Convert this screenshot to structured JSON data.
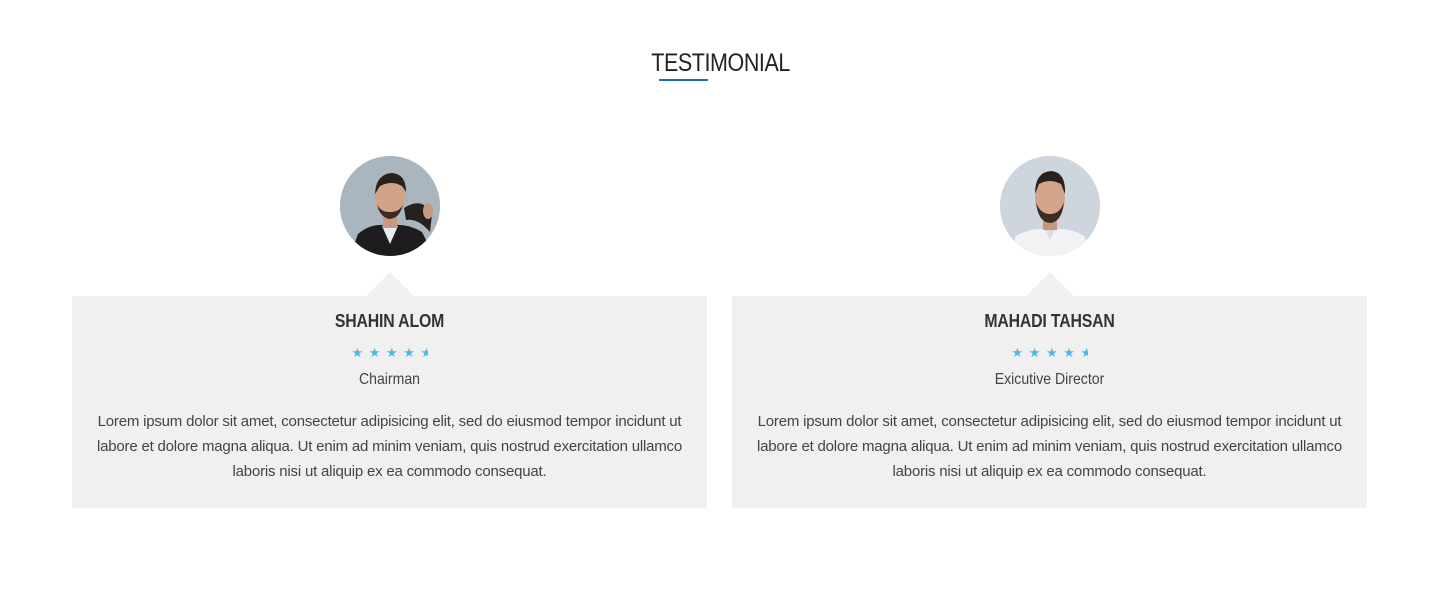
{
  "section": {
    "title": "TESTIMONIAL",
    "accent_color": "#1f6fb8"
  },
  "testimonials": [
    {
      "avatar_icon": "person-avatar",
      "name": "SHAHIN ALOM",
      "rating": 4.5,
      "stars": [
        "★",
        "★",
        "★",
        "★",
        "★"
      ],
      "role": "Chairman",
      "quote": "Lorem ipsum dolor sit amet, consectetur adipisicing elit, sed do eiusmod tempor incidunt ut labore et dolore magna aliqua. Ut enim ad minim veniam, quis nostrud exercitation ullamco laboris nisi ut aliquip ex ea commodo consequat."
    },
    {
      "avatar_icon": "person-avatar",
      "name": "MAHADI TAHSAN",
      "rating": 4.5,
      "stars": [
        "★",
        "★",
        "★",
        "★",
        "★"
      ],
      "role": "Exicutive Director",
      "quote": "Lorem ipsum dolor sit amet, consectetur adipisicing elit, sed do eiusmod tempor incidunt ut labore et dolore magna aliqua. Ut enim ad minim veniam, quis nostrud exercitation ullamco laboris nisi ut aliquip ex ea commodo consequat."
    }
  ],
  "colors": {
    "star": "#4db7e8",
    "card_bg": "#f0f0f0",
    "text": "#444444"
  }
}
